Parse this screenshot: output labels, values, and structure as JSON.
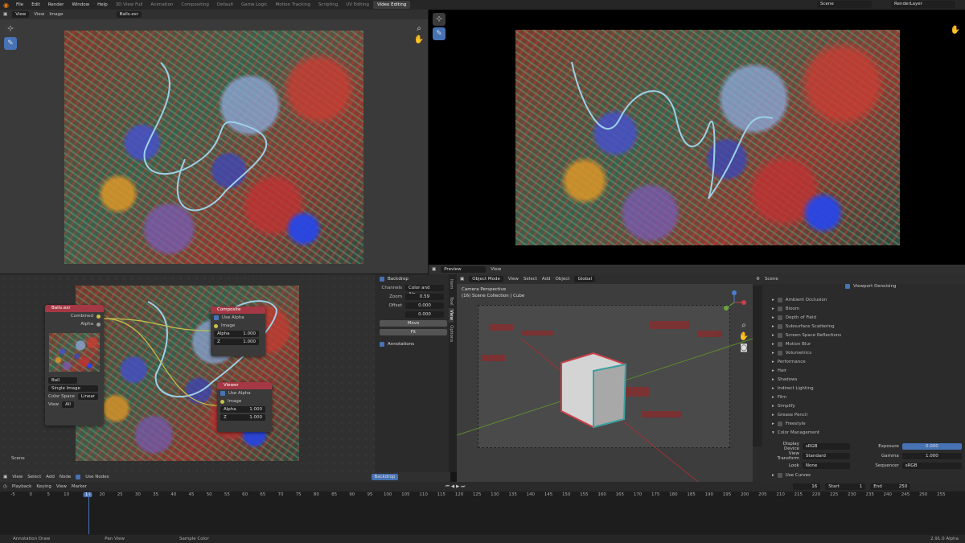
{
  "menu": [
    "File",
    "Edit",
    "Render",
    "Window",
    "Help"
  ],
  "workspaces": [
    "3D View Full",
    "Animation",
    "Compositing",
    "Default",
    "Game Logic",
    "Motion Tracking",
    "Scripting",
    "UV Editing",
    "Video Editing"
  ],
  "active_workspace": "Video Editing",
  "scene_name": "Scene",
  "view_layer": "RenderLayer",
  "image_editor": {
    "view_menu": "View",
    "menu2": "View",
    "menu3": "Image",
    "image_name": "Balls.exr"
  },
  "render_header": {
    "preview": "Preview",
    "view": "View"
  },
  "node_editor": {
    "balls_node": {
      "title": "Balls.exr",
      "out1": "Combined",
      "out2": "Alpha",
      "img_field": "Ball",
      "source": "Single Image",
      "color_space_label": "Color Space",
      "color_space": "Linear",
      "view_label": "View",
      "view_value": "All"
    },
    "composite_node": {
      "title": "Composite",
      "use_alpha": "Use Alpha",
      "image": "Image",
      "alpha_label": "Alpha",
      "alpha_val": "1.000",
      "z_label": "Z",
      "z_val": "1.000"
    },
    "viewer_node": {
      "title": "Viewer",
      "use_alpha": "Use Alpha",
      "image": "Image",
      "alpha_label": "Alpha",
      "alpha_val": "1.000",
      "z_label": "Z",
      "z_val": "1.000"
    },
    "scene_label": "Scene",
    "header": {
      "view": "View",
      "select": "Select",
      "add": "Add",
      "node": "Node",
      "use_nodes": "Use Nodes",
      "backdrop": "Backdrop"
    }
  },
  "sidepanel": {
    "backdrop": "Backdrop",
    "channels_label": "Channels",
    "channels_value": "Color and Alp...",
    "zoom_label": "Zoom",
    "zoom_val": "0.59",
    "offset_label": "Offset",
    "offset_x": "0.000",
    "offset_y": "0.000",
    "move": "Move",
    "fit": "Fit",
    "annotations": "Annotations",
    "tabs": [
      "Item",
      "Tool",
      "View",
      "Options"
    ]
  },
  "viewport": {
    "mode": "Object Mode",
    "view": "View",
    "select": "Select",
    "add": "Add",
    "object": "Object",
    "orientation": "Global",
    "camera_label": "Camera Perspective",
    "collection_label": "(16) Scene Collection | Cube"
  },
  "properties": {
    "scene_title": "Scene",
    "viewport_denoising": "Viewport Denoising",
    "sections": [
      "Ambient Occlusion",
      "Bloom",
      "Depth of Field",
      "Subsurface Scattering",
      "Screen Space Reflections",
      "Motion Blur",
      "Volumetrics",
      "Performance",
      "Hair",
      "Shadows",
      "Indirect Lighting",
      "Film",
      "Simplify",
      "Grease Pencil",
      "Freestyle",
      "Color Management"
    ],
    "display_device_label": "Display Device",
    "display_device": "sRGB",
    "view_transform_label": "View Transform",
    "view_transform": "Standard",
    "look_label": "Look",
    "look": "None",
    "exposure_label": "Exposure",
    "exposure": "0.000",
    "gamma_label": "Gamma",
    "gamma": "1.000",
    "sequencer_label": "Sequencer",
    "sequencer": "sRGB",
    "use_curves": "Use Curves"
  },
  "timeline": {
    "playback": "Playback",
    "keying": "Keying",
    "view": "View",
    "marker": "Marker",
    "current_frame": "16",
    "start_label": "Start",
    "start": "1",
    "end_label": "End",
    "end": "250",
    "ticks": [
      "-5",
      "0",
      "5",
      "10",
      "16",
      "20",
      "25",
      "30",
      "35",
      "40",
      "45",
      "50",
      "55",
      "60",
      "65",
      "70",
      "75",
      "80",
      "85",
      "90",
      "95",
      "100",
      "105",
      "110",
      "115",
      "120",
      "125",
      "130",
      "135",
      "140",
      "145",
      "150",
      "155",
      "160",
      "165",
      "170",
      "175",
      "180",
      "185",
      "190",
      "195",
      "200",
      "205",
      "210",
      "215",
      "220",
      "225",
      "230",
      "235",
      "240",
      "245",
      "250",
      "255"
    ]
  },
  "status": {
    "left": "Annotation Draw",
    "mid": "Pan View",
    "right": "Sample Color",
    "version": "2.91.0 Alpha"
  },
  "colors": {
    "accent": "#4772b3",
    "node_header": "#a43844",
    "curve": "#9dd0e8"
  }
}
